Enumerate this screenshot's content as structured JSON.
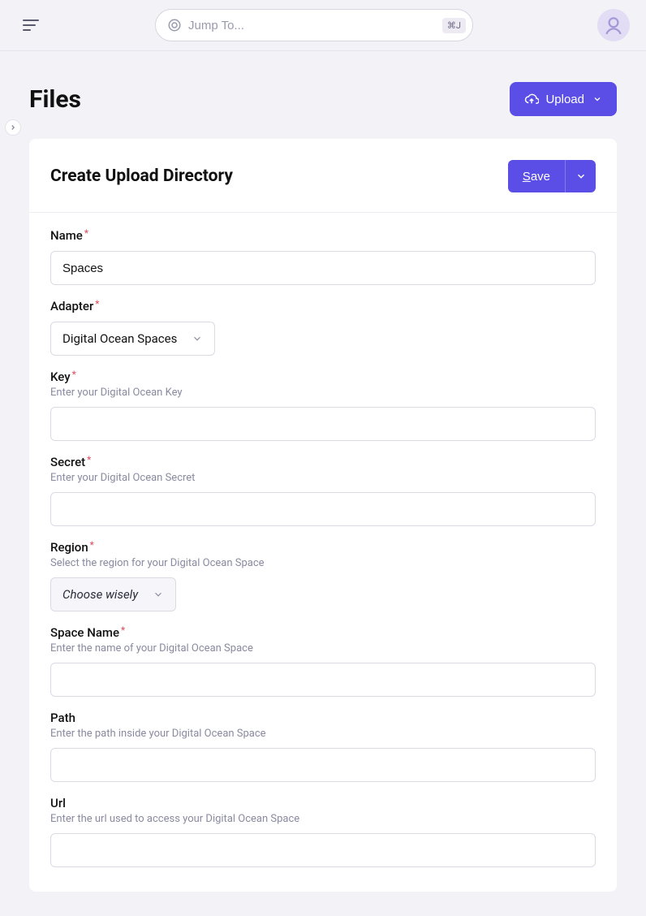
{
  "header": {
    "jump_placeholder": "Jump To...",
    "kbd_shortcut": "⌘J"
  },
  "page": {
    "title": "Files",
    "upload_label": "Upload"
  },
  "card": {
    "title": "Create Upload Directory",
    "save_label_prefix": "S",
    "save_label_rest": "ave"
  },
  "form": {
    "name": {
      "label": "Name",
      "value": "Spaces"
    },
    "adapter": {
      "label": "Adapter",
      "value": "Digital Ocean Spaces"
    },
    "key": {
      "label": "Key",
      "hint": "Enter your Digital Ocean Key",
      "value": ""
    },
    "secret": {
      "label": "Secret",
      "hint": "Enter your Digital Ocean Secret",
      "value": ""
    },
    "region": {
      "label": "Region",
      "hint": "Select the region for your Digital Ocean Space",
      "value": "Choose wisely"
    },
    "space_name": {
      "label": "Space Name",
      "hint": "Enter the name of your Digital Ocean Space",
      "value": ""
    },
    "path": {
      "label": "Path",
      "hint": "Enter the path inside your Digital Ocean Space",
      "value": ""
    },
    "url": {
      "label": "Url",
      "hint": "Enter the url used to access your Digital Ocean Space",
      "value": ""
    }
  }
}
